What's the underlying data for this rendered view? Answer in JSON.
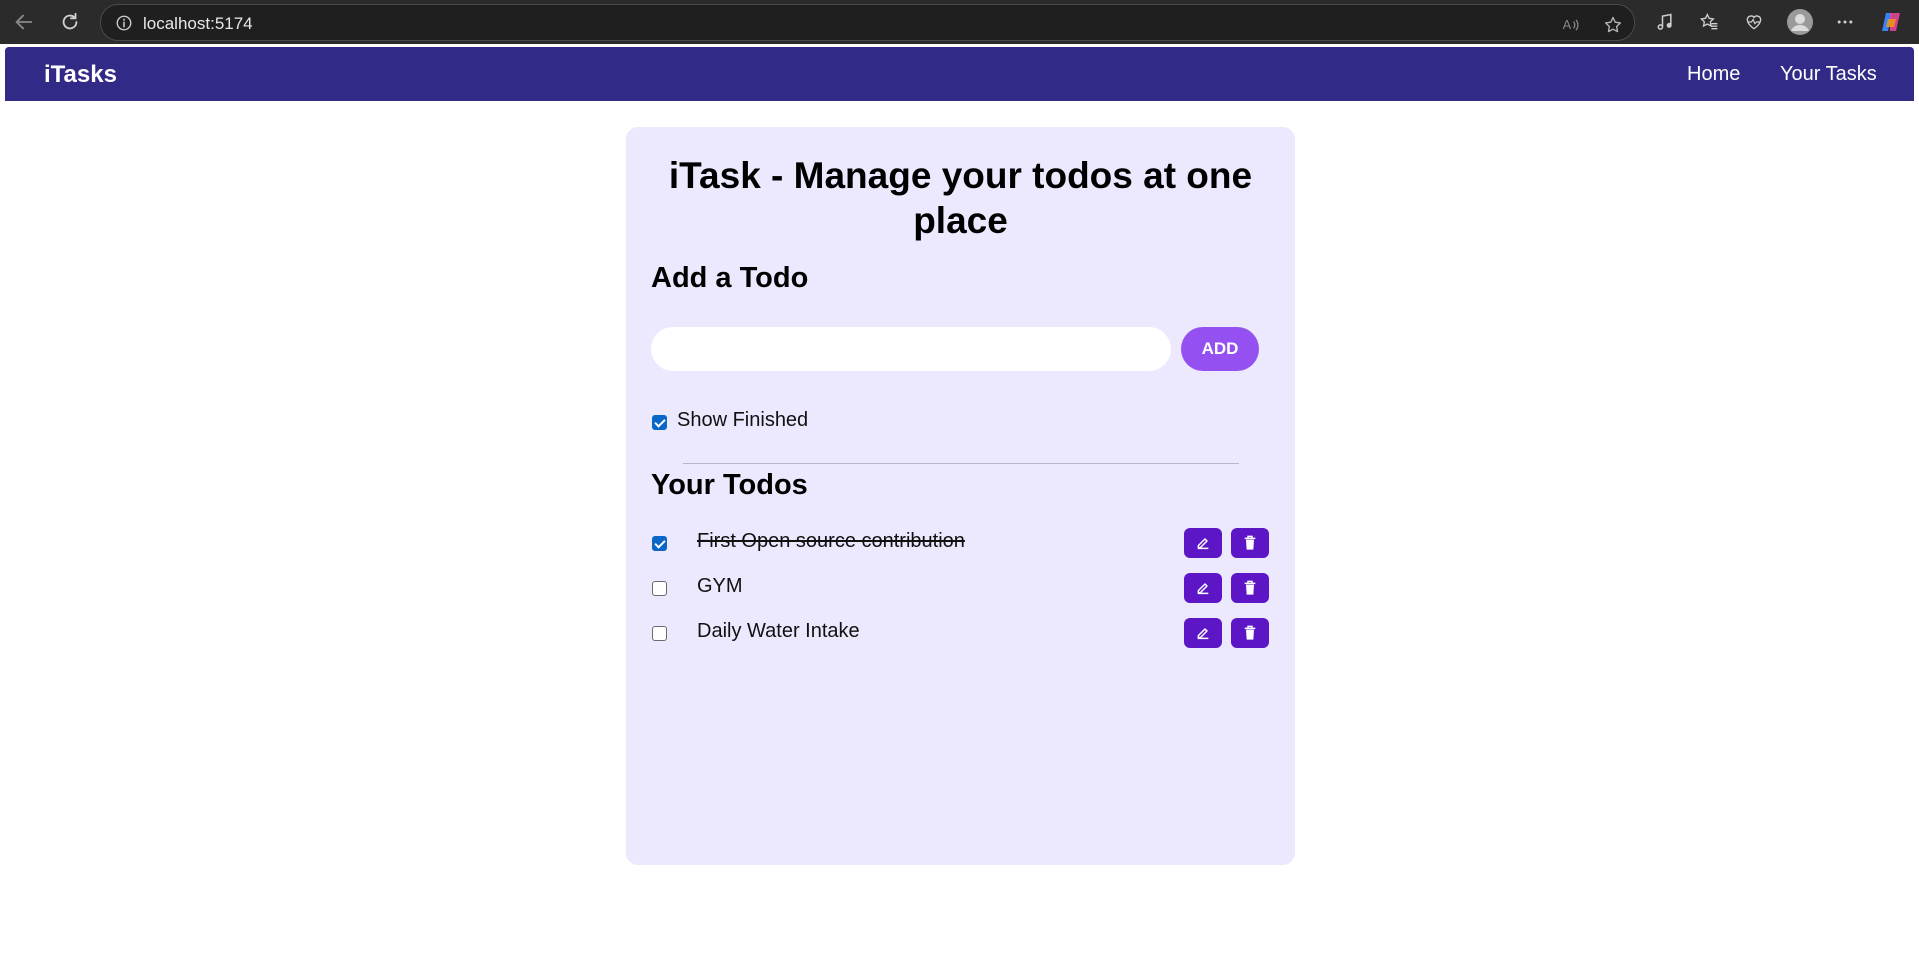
{
  "browser": {
    "url": "localhost:5174"
  },
  "navbar": {
    "brand": "iTasks",
    "links": [
      "Home",
      "Your Tasks"
    ]
  },
  "card": {
    "title": "iTask - Manage your todos at one place",
    "add_heading": "Add a Todo",
    "input_value": "",
    "add_button": "ADD",
    "show_finished_label": "Show Finished",
    "show_finished_checked": true,
    "todos_heading": "Your Todos",
    "todos": [
      {
        "text": "First Open source contribution",
        "done": true
      },
      {
        "text": "GYM",
        "done": false
      },
      {
        "text": "Daily Water Intake",
        "done": false
      }
    ]
  },
  "colors": {
    "navbar": "#312a87",
    "card": "#ece8fd",
    "add_button": "#9450f0",
    "icon_button": "#5c16c5",
    "checkbox": "#0a67c7"
  },
  "icons": {
    "edit": "edit-icon",
    "delete": "trash-icon"
  }
}
